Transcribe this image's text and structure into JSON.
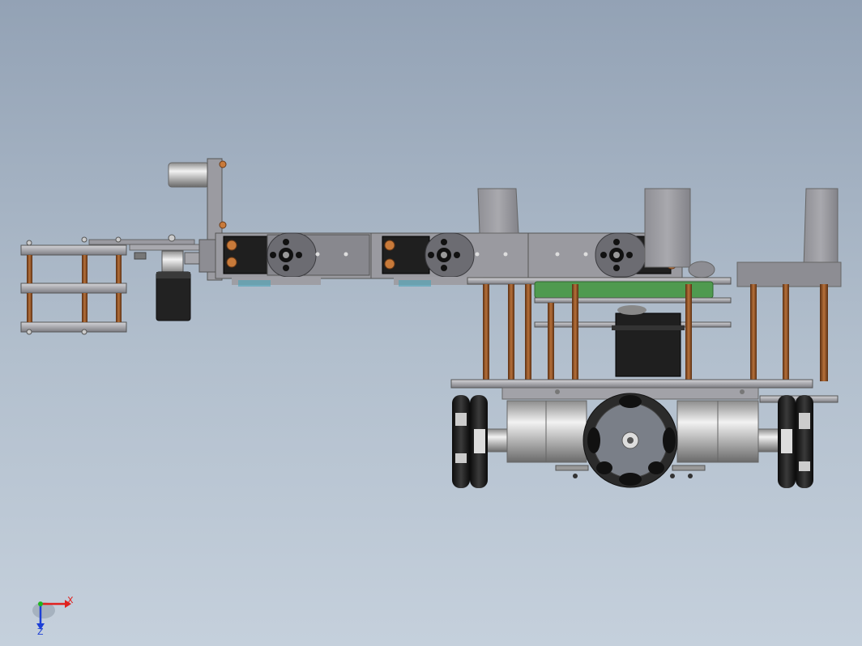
{
  "triad": {
    "x_label": "X",
    "z_label": "Z",
    "x_color": "#e0211e",
    "y_color": "#1fb51f",
    "z_color": "#1c3fd6"
  },
  "colors": {
    "background_top": "#93a2b5",
    "background_bottom": "#c5d0dc",
    "plate": "#8e8e94",
    "standoff": "#8a4d22",
    "servo_body": "#2c2c2c",
    "motor_metal": "#b8b8b8",
    "pcb_green": "#4f9a4f",
    "wheel_roller": "#1b1b1b",
    "screw": "#c87a3a"
  },
  "icons": {
    "coordinate_triad": "xyz-triad-icon"
  }
}
